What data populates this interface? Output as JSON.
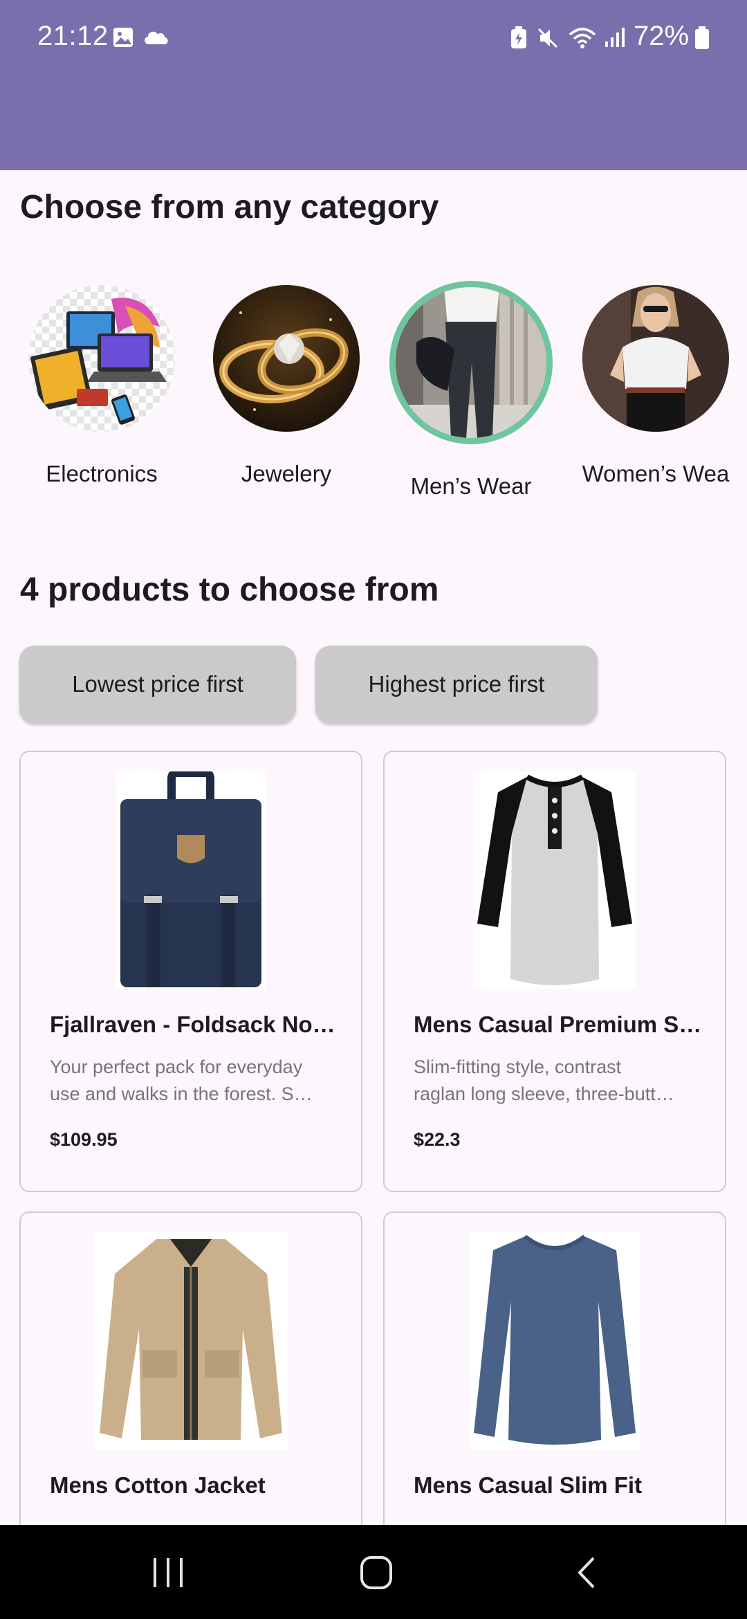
{
  "status_bar": {
    "time": "21:12",
    "battery": "72%",
    "left_icons": [
      "gallery-icon",
      "cloud-icon"
    ],
    "right_icons": [
      "battery-saver-icon",
      "mute-icon",
      "wifi-icon",
      "signal-icon",
      "battery-icon"
    ]
  },
  "categories": {
    "title": "Choose from any category",
    "items": [
      {
        "label": "Electronics",
        "selected": false
      },
      {
        "label": "Jewelery",
        "selected": false
      },
      {
        "label": "Men’s Wear",
        "selected": true
      },
      {
        "label": "Women’s Wea",
        "selected": false
      }
    ]
  },
  "products": {
    "title": "4 products to choose from",
    "sort_low": "Lowest price first",
    "sort_high": "Highest price first",
    "items": [
      {
        "name": "Fjallraven - Foldsack No…",
        "desc1": "Your perfect pack for everyday",
        "desc2": "use and walks in the forest. S…",
        "price": "$109.95"
      },
      {
        "name": "Mens Casual Premium S…",
        "desc1": "Slim-fitting style, contrast",
        "desc2": "raglan long sleeve, three-butt…",
        "price": "$22.3"
      },
      {
        "name": "Mens Cotton Jacket"
      },
      {
        "name": "Mens Casual Slim Fit"
      }
    ]
  },
  "colors": {
    "app_bar": "#7b6ead",
    "background": "#fdf7fd",
    "selected_ring": "#6ec59e",
    "sort_button": "#cacaca"
  },
  "nav_bar": {
    "icons": [
      "recent-apps-icon",
      "home-icon",
      "back-icon"
    ]
  }
}
